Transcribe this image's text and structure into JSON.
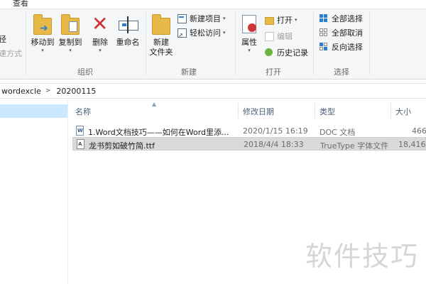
{
  "tabs": {
    "view": "查看"
  },
  "ribbon": {
    "clipboard_partial": {
      "line1": "径",
      "line2": "速方式"
    },
    "organize": {
      "move_to": "移动到",
      "copy_to": "复制到",
      "delete": "删除",
      "rename": "重命名",
      "group_label": "组织"
    },
    "new": {
      "new_folder_line1": "新建",
      "new_folder_line2": "文件夹",
      "new_item": "新建项目",
      "easy_access": "轻松访问",
      "group_label": "新建"
    },
    "open": {
      "properties": "属性",
      "open": "打开",
      "edit": "编辑",
      "history": "历史记录",
      "group_label": "打开"
    },
    "select": {
      "select_all": "全部选择",
      "select_none": "全部取消",
      "invert": "反向选择",
      "group_label": "选择"
    }
  },
  "address": {
    "crumb_parent": "wordexcle",
    "separator": ">",
    "crumb_current": "20200115"
  },
  "columns": {
    "name": "名称",
    "modified": "修改日期",
    "type": "类型",
    "size": "大小"
  },
  "files": [
    {
      "name": "1.Word文档技巧——如何在Word里添...",
      "modified": "2020/1/15 16:19",
      "type": "DOC 文档",
      "size": "466",
      "icon": "word-doc-icon"
    },
    {
      "name": "龙书剪如破竹简.ttf",
      "modified": "2018/4/4 18:33",
      "type": "TrueType 字体文件",
      "size": "18,416",
      "icon": "font-file-icon"
    }
  ],
  "watermark": "软件技巧",
  "colors": {
    "ribbon_bg": "#f5f6f7",
    "selection_blue": "#cce8ff",
    "row_selected": "#d9d9d9",
    "delete_red": "#d13438",
    "header_text": "#4c607a"
  }
}
